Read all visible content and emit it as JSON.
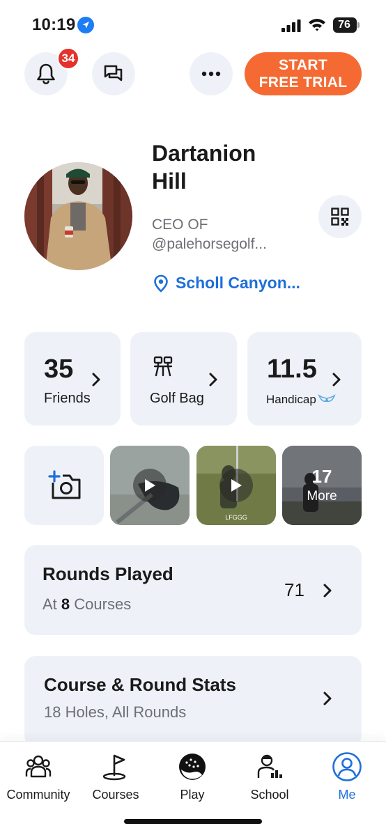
{
  "status_bar": {
    "time": "10:19",
    "battery": "76"
  },
  "header": {
    "notification_count": "34",
    "trial_line1": "START",
    "trial_line2": "FREE TRIAL"
  },
  "profile": {
    "first_name": "Dartanion",
    "last_name": "Hill",
    "bio_line1": "CEO OF",
    "bio_line2": "@palehorsegolf...",
    "location": "Scholl Canyon..."
  },
  "stats": {
    "friends_value": "35",
    "friends_label": "Friends",
    "bag_label": "Golf Bag",
    "handicap_value": "11.5",
    "handicap_label": "Handicap"
  },
  "media": {
    "more_count": "17",
    "more_label": "More",
    "watermark": "LFGGG"
  },
  "rounds": {
    "title": "Rounds Played",
    "sub_prefix": "At",
    "course_count": "8",
    "sub_suffix": "Courses",
    "value": "71"
  },
  "course_stats": {
    "title": "Course & Round Stats",
    "subtitle": "18 Holes, All Rounds"
  },
  "tabs": [
    {
      "label": "Community",
      "icon": "community-icon"
    },
    {
      "label": "Courses",
      "icon": "flag-icon"
    },
    {
      "label": "Play",
      "icon": "golf-ball-icon"
    },
    {
      "label": "School",
      "icon": "school-icon"
    },
    {
      "label": "Me",
      "icon": "profile-icon"
    }
  ],
  "colors": {
    "accent": "#1e6fd9",
    "trial": "#f56a33",
    "badge": "#e5312b",
    "card": "#eef2f8"
  }
}
